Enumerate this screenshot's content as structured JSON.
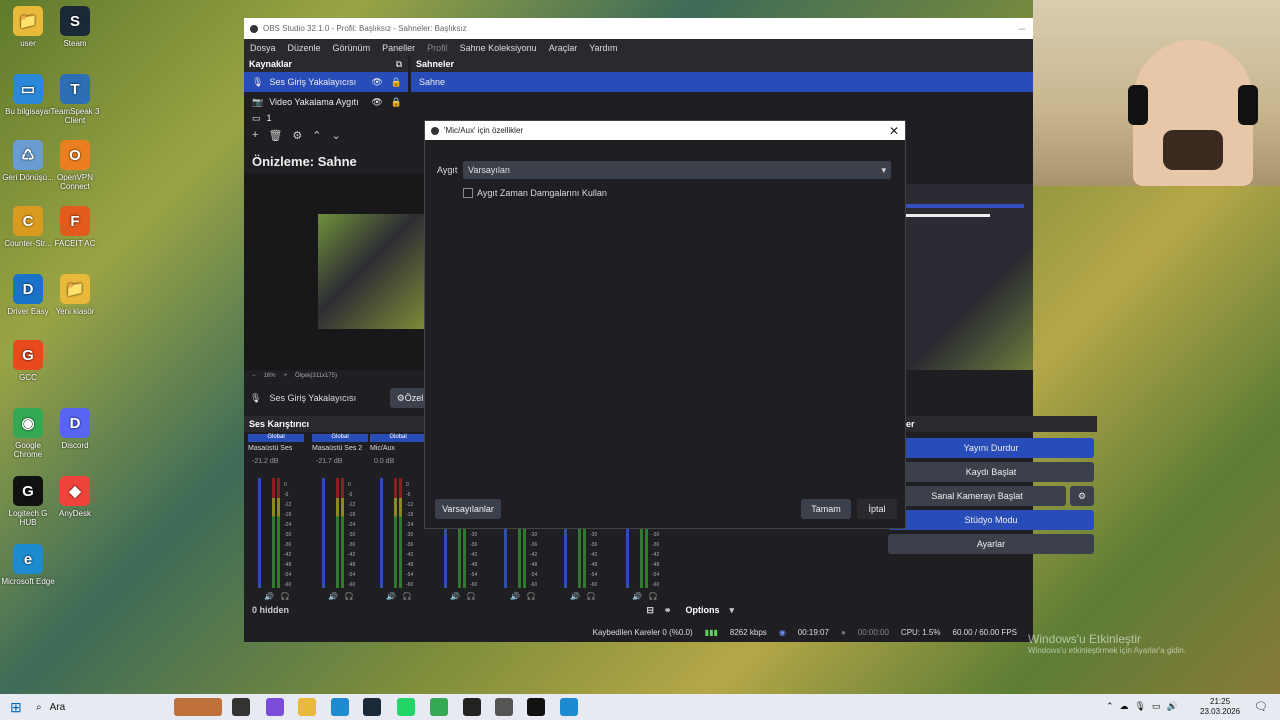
{
  "desktop": {
    "icons": [
      {
        "label": "user",
        "color": "#e8b93a",
        "glyph": "📁"
      },
      {
        "label": "Steam",
        "color": "#1b2838",
        "glyph": "S"
      },
      {
        "label": "Bu bilgisayar",
        "color": "#2b88d8",
        "glyph": "▭"
      },
      {
        "label": "TeamSpeak 3 Client",
        "color": "#2c6fb5",
        "glyph": "T"
      },
      {
        "label": "Geri Dönüşü...",
        "color": "#6a9bd1",
        "glyph": "♺"
      },
      {
        "label": "OpenVPN Connect",
        "color": "#ea7e20",
        "glyph": "O"
      },
      {
        "label": "Counter-Str...",
        "color": "#d89b1f",
        "glyph": "C"
      },
      {
        "label": "FACEIT AC",
        "color": "#e25a1c",
        "glyph": "F"
      },
      {
        "label": "Driver Easy",
        "color": "#1b73c9",
        "glyph": "D"
      },
      {
        "label": "Yeni klasör",
        "color": "#e8b93a",
        "glyph": "📁"
      },
      {
        "label": "GCC",
        "color": "#e8491d",
        "glyph": "G"
      },
      {
        "label": "Google Chrome",
        "color": "#34a853",
        "glyph": "◉"
      },
      {
        "label": "Discord",
        "color": "#5865f2",
        "glyph": "D"
      },
      {
        "label": "Logitech G HUB",
        "color": "#111111",
        "glyph": "G"
      },
      {
        "label": "AnyDesk",
        "color": "#ef443b",
        "glyph": "◆"
      },
      {
        "label": "Microsoft Edge",
        "color": "#1e8bd0",
        "glyph": "e"
      }
    ],
    "watermark_title": "Windows'u Etkinleştir",
    "watermark_sub": "Windows'u etkinleştirmek için Ayarlar'a gidin."
  },
  "obs": {
    "title": "OBS Studio 32.1.0 - Profil: Başlıksız - Sahneler: Başlıksız",
    "menu": [
      "Dosya",
      "Düzenle",
      "Görünüm",
      "Paneller",
      "Profil",
      "Sahne Koleksiyonu",
      "Araçlar",
      "Yardım"
    ],
    "sources_header": "Kaynaklar",
    "sources": [
      "Ses Giriş Yakalayıcısı",
      "Video Yakalama Aygıtı",
      "1"
    ],
    "scenes_header": "Sahneler",
    "scenes": [
      "Sahne"
    ],
    "preview_title": "Önizleme: Sahne",
    "zoom": "16%",
    "canvas_label": "Ölçek(311x175)",
    "source_bar_label": "Ses Giriş Yakalayıcısı",
    "properties_btn": "Özel",
    "mixer_header": "Ses Karıştırıcı",
    "mixer_channels": [
      {
        "tag": "Global",
        "name": "Masaüstü Ses",
        "db": "-21.2 dB"
      },
      {
        "tag": "Global",
        "name": "Masaüstü Ses 2",
        "db": "-21.7 dB"
      },
      {
        "tag": "Global",
        "name": "Mic/Aux",
        "db": "0.0 dB"
      }
    ],
    "meter_ticks": [
      "0",
      "-6",
      "-12",
      "-18",
      "-24",
      "-30",
      "-36",
      "-42",
      "-48",
      "-54",
      "-60"
    ],
    "hidden_label": "0 hidden",
    "options_label": "Options",
    "controls_header": "troller",
    "controls": [
      "Yayını Durdur",
      "Kaydı Başlat",
      "Sanal Kamerayı Başlat",
      "Stüdyo Modu",
      "Ayarlar"
    ],
    "status": {
      "dropped": "Kaybedilen Kareler 0 (%0.0)",
      "bitrate": "8262 kbps",
      "stream_time": "00:19:07",
      "rec_time": "00:00:00",
      "cpu": "CPU: 1.5%",
      "fps": "60.00 / 60.00 FPS"
    }
  },
  "dialog": {
    "title": "'Mic/Aux' için özellikler",
    "device_label": "Aygıt",
    "device_value": "Varsayılan",
    "checkbox_label": "Aygıt Zaman Damgalarını Kullan",
    "checkbox_checked": false,
    "defaults_btn": "Varsayılanlar",
    "ok_btn": "Tamam",
    "cancel_btn": "İptal"
  },
  "taskbar": {
    "search": "Ara",
    "time": "21:25",
    "date": "23.03.2026"
  },
  "colors": {
    "accent": "#284cb8",
    "panel": "#1f1f23",
    "header": "#2a2a2e"
  }
}
